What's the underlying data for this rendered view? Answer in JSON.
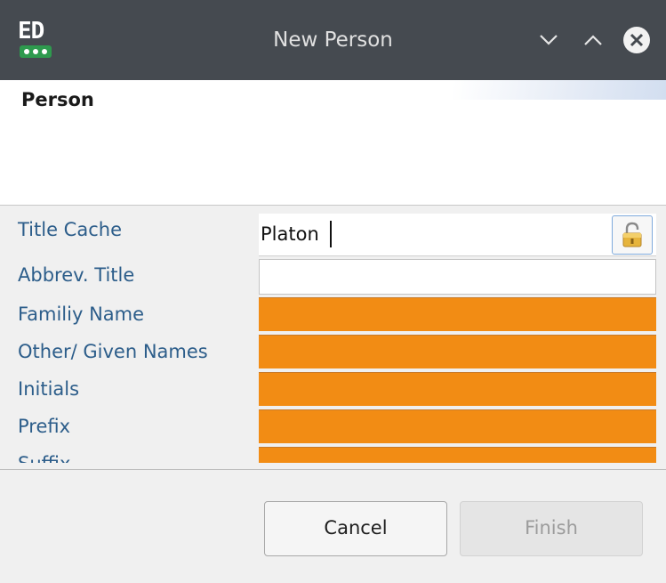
{
  "window": {
    "title": "New Person",
    "app_icon": {
      "letters": "ED",
      "icon": "app-logo-icon"
    },
    "controls": {
      "minimize_icon": "chevron-down-icon",
      "maximize_icon": "chevron-up-icon",
      "close_icon": "close-circle-icon"
    }
  },
  "header": {
    "title": "Person"
  },
  "form": {
    "fields": [
      {
        "label": "Title Cache",
        "value": "Platon",
        "state": "editable-with-lock"
      },
      {
        "label": "Abbrev. Title",
        "value": "",
        "state": "normal"
      },
      {
        "label": "Familiy Name",
        "value": "",
        "state": "disabled-orange"
      },
      {
        "label": "Other/ Given Names",
        "value": "",
        "state": "disabled-orange"
      },
      {
        "label": "Initials",
        "value": "",
        "state": "disabled-orange"
      },
      {
        "label": "Prefix",
        "value": "",
        "state": "disabled-orange"
      },
      {
        "label": "Suffix",
        "value": "",
        "state": "disabled-orange"
      }
    ],
    "lock_icon": "unlocked-padlock-icon"
  },
  "buttons": {
    "cancel_label": "Cancel",
    "finish_label": "Finish"
  },
  "colors": {
    "titlebar": "#454a50",
    "label_text": "#2c5d8a",
    "orange_field": "#f28c14",
    "focus_border": "#7faadc"
  }
}
